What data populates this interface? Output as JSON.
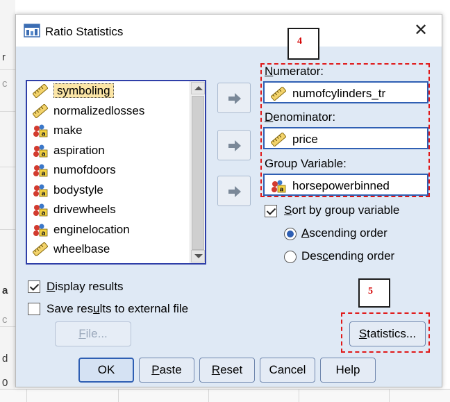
{
  "background": {
    "left_chars": [
      "r",
      "c",
      "a",
      "c",
      "d",
      "0"
    ]
  },
  "dialog": {
    "title": "Ratio Statistics",
    "close_glyph": "✕"
  },
  "variables": [
    {
      "name": "symboling",
      "type": "scale",
      "selected": true
    },
    {
      "name": "normalizedlosses",
      "type": "scale"
    },
    {
      "name": "make",
      "type": "nominal"
    },
    {
      "name": "aspiration",
      "type": "nominal"
    },
    {
      "name": "numofdoors",
      "type": "nominal"
    },
    {
      "name": "bodystyle",
      "type": "nominal"
    },
    {
      "name": "drivewheels",
      "type": "nominal"
    },
    {
      "name": "enginelocation",
      "type": "nominal"
    },
    {
      "name": "wheelbase",
      "type": "scale"
    }
  ],
  "numerator": {
    "label_key": "N",
    "label_rest": "umerator:",
    "value": "numofcylinders_tr"
  },
  "denominator": {
    "label_key": "D",
    "label_rest": "enominator:",
    "value": "price"
  },
  "group": {
    "label_pre": "Group Variable:",
    "value": "horsepowerbinned"
  },
  "sort": {
    "key": "S",
    "rest": "ort by group variable",
    "checked": true
  },
  "ascending": {
    "key": "A",
    "rest": "scending order",
    "checked": true
  },
  "descending": {
    "pre": "Des",
    "key": "c",
    "rest": "ending order",
    "checked": false
  },
  "display_results": {
    "key": "D",
    "rest": "isplay results",
    "checked": true
  },
  "save_results": {
    "pre": "Save res",
    "key": "u",
    "rest": "lts to external file",
    "checked": false
  },
  "buttons": {
    "file": {
      "key": "F",
      "rest": "ile..."
    },
    "statistics": {
      "key": "S",
      "rest": "tatistics..."
    },
    "ok": "OK",
    "paste": {
      "key": "P",
      "rest": "aste"
    },
    "reset": {
      "key": "R",
      "rest": "eset"
    },
    "cancel": "Cancel",
    "help": "Help"
  },
  "annotations": {
    "step4": "4",
    "step5": "5"
  },
  "colors": {
    "accent": "#2f5fb3",
    "annotation_red": "#e01818",
    "client_bg": "#dfe9f5"
  }
}
